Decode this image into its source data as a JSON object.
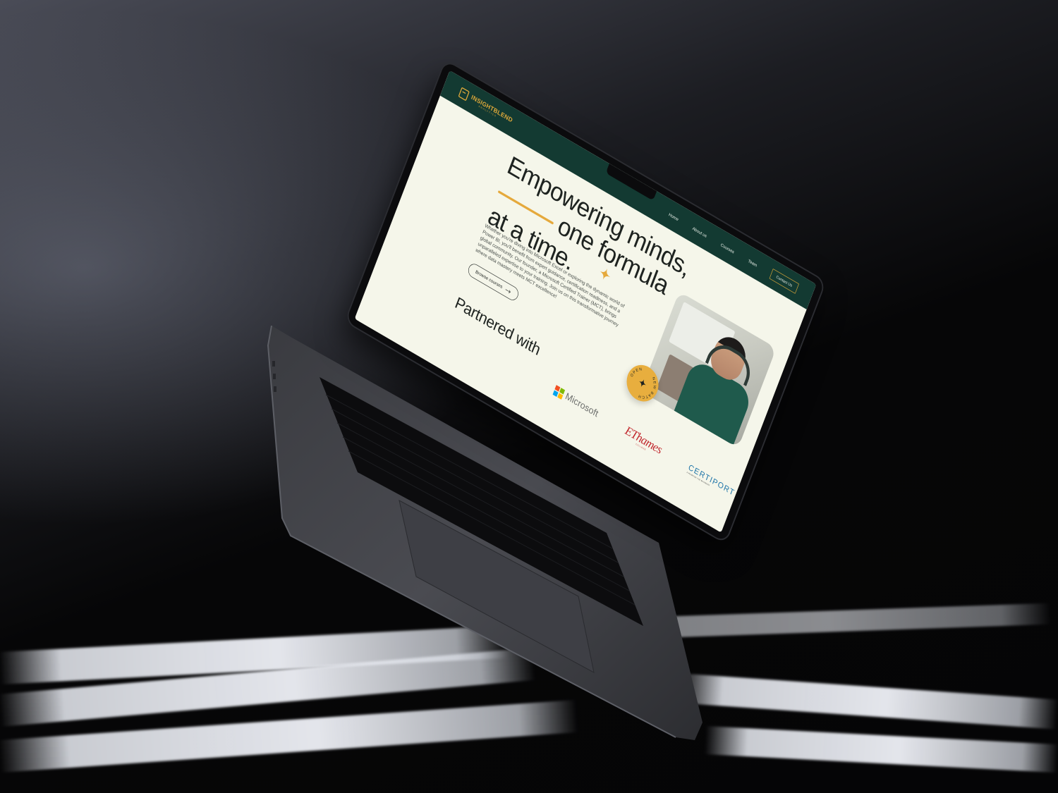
{
  "site": {
    "logo_name": "INSIGHTBLEND",
    "logo_sub": "ANALYTICS",
    "nav": [
      {
        "label": "Home"
      },
      {
        "label": "About us"
      },
      {
        "label": "Courses"
      },
      {
        "label": "Team"
      }
    ],
    "contact_label": "Contact Us",
    "colors": {
      "nav_bg": "#133a32",
      "accent": "#e5a93c",
      "page_bg": "#f5f6ea"
    }
  },
  "hero": {
    "title_line1": "Empowering minds,",
    "title_line2": "one formula",
    "title_line3": "at a time.",
    "description": "Whether you're diving into Microsoft Excel or exploring the dynamic world of Power BI, you'll benefit from expert guidance, certification readiness, and a global community. Our founder, a Microsoft Certified Trainer (MCT), brings unparalleled expertise to your training. Join us on this transformative journey where data mastery meets MCT excellence!",
    "browse_label": "Browse courses",
    "badge_top": "OPEN",
    "badge_bottom": "NEW BATCH"
  },
  "partners": {
    "title": "Partnered with",
    "microsoft": "Microsoft",
    "ethames": "EThames",
    "ethames_tag": "COLLEGE",
    "certiport": "CERTIPORT",
    "certiport_tag": "A PEARSON VUE BUSINESS"
  },
  "icons": [
    "logo-mark-icon",
    "sparkle-icon",
    "arrow-right-icon",
    "star-icon"
  ]
}
